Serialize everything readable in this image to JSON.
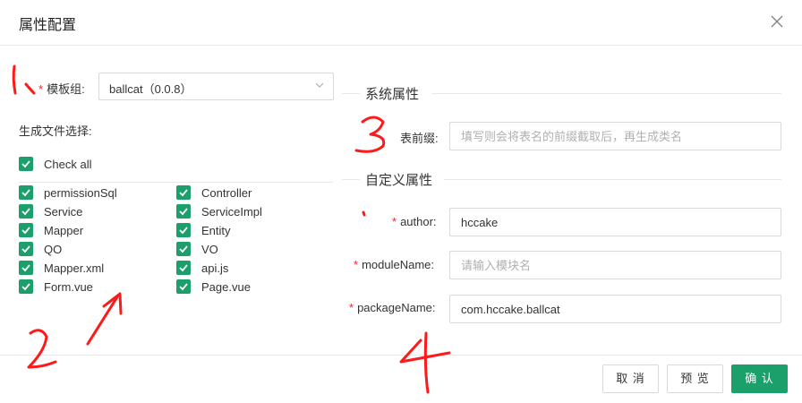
{
  "dialog": {
    "title": "属性配置"
  },
  "template_group": {
    "label": "模板组:",
    "value": "ballcat（0.0.8）"
  },
  "file_select": {
    "label": "生成文件选择:",
    "check_all": "Check all",
    "left": [
      "permissionSql",
      "Service",
      "Mapper",
      "QO",
      "Mapper.xml",
      "Form.vue"
    ],
    "right": [
      "Controller",
      "ServiceImpl",
      "Entity",
      "VO",
      "api.js",
      "Page.vue"
    ]
  },
  "system_props": {
    "title": "系统属性",
    "prefix_label": "表前缀:",
    "prefix_placeholder": "填写则会将表名的前缀截取后，再生成类名"
  },
  "custom_props": {
    "title": "自定义属性",
    "author_label": "author:",
    "author_value": "hccake",
    "module_label": "moduleName:",
    "module_placeholder": "请输入模块名",
    "package_label": "packageName:",
    "package_value": "com.hccake.ballcat"
  },
  "footer": {
    "cancel": "取 消",
    "preview": "预 览",
    "confirm": "确 认"
  },
  "colors": {
    "accent": "#1b9f6b",
    "required": "#f5222d",
    "annotation": "#ff0000"
  }
}
